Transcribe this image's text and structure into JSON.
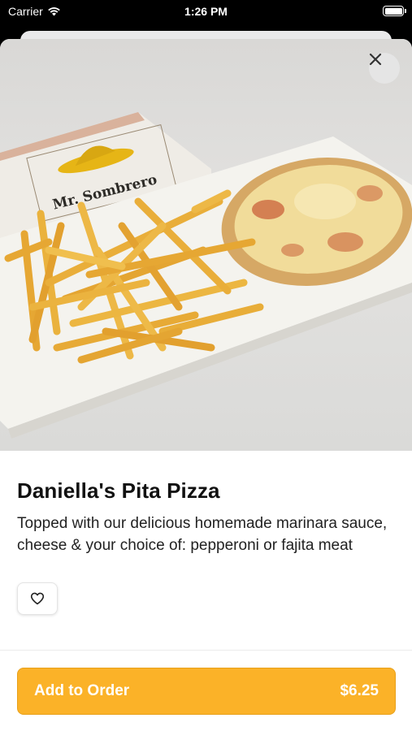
{
  "status_bar": {
    "carrier": "Carrier",
    "time": "1:26 PM"
  },
  "hero_image": {
    "logo_text": "Mr. Sombrero",
    "alt": "Pita pizza with french fries on a white plate"
  },
  "item": {
    "name": "Daniella's Pita Pizza",
    "description": "Topped with our delicious homemade marinara sauce, cheese & your choice of: pepperoni or fajita meat"
  },
  "actions": {
    "add_to_order_label": "Add to Order",
    "price": "$6.25"
  },
  "colors": {
    "accent": "#fbb228",
    "text": "#111111"
  },
  "icons": {
    "close": "close-icon",
    "favorite": "heart-outline-icon",
    "wifi": "wifi-icon",
    "battery": "battery-icon"
  }
}
